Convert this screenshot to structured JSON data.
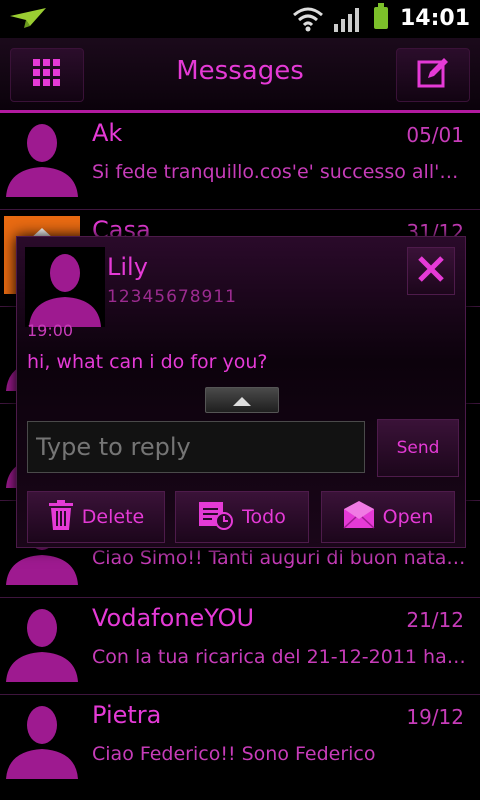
{
  "status_bar": {
    "time": "14:01",
    "icons": [
      "notification-icon",
      "wifi-icon",
      "signal-icon",
      "battery-icon"
    ],
    "battery_color": "#7cc02a"
  },
  "action_bar": {
    "title": "Messages",
    "left_icon": "grid-icon",
    "right_icon": "compose-icon",
    "accent": "#e53ad6"
  },
  "messages": [
    {
      "name": "Ak",
      "date": "05/01",
      "snippet": "Si fede tranquillo.cos'e' successo all'un..."
    },
    {
      "name": "Casa",
      "date": "31/12",
      "snippet": ""
    },
    {
      "name": "",
      "date": "",
      "snippet": ""
    },
    {
      "name": "",
      "date": "",
      "snippet": ""
    },
    {
      "name": "",
      "date": "",
      "snippet": "Ciao Simo!! Tanti auguri di buon natal..."
    },
    {
      "name": "VodafoneYOU",
      "date": "21/12",
      "snippet": "Con la tua ricarica del 21-12-2011 hai ..."
    },
    {
      "name": "Pietra",
      "date": "19/12",
      "snippet": "Ciao Federico!! Sono Federico"
    }
  ],
  "popup": {
    "contact_name": "Lily",
    "contact_number": "12345678911",
    "time": "19:00",
    "message": "hi, what can i do for you?",
    "reply_placeholder": "Type to reply",
    "send_label": "Send",
    "delete_label": "Delete",
    "todo_label": "Todo",
    "open_label": "Open"
  }
}
